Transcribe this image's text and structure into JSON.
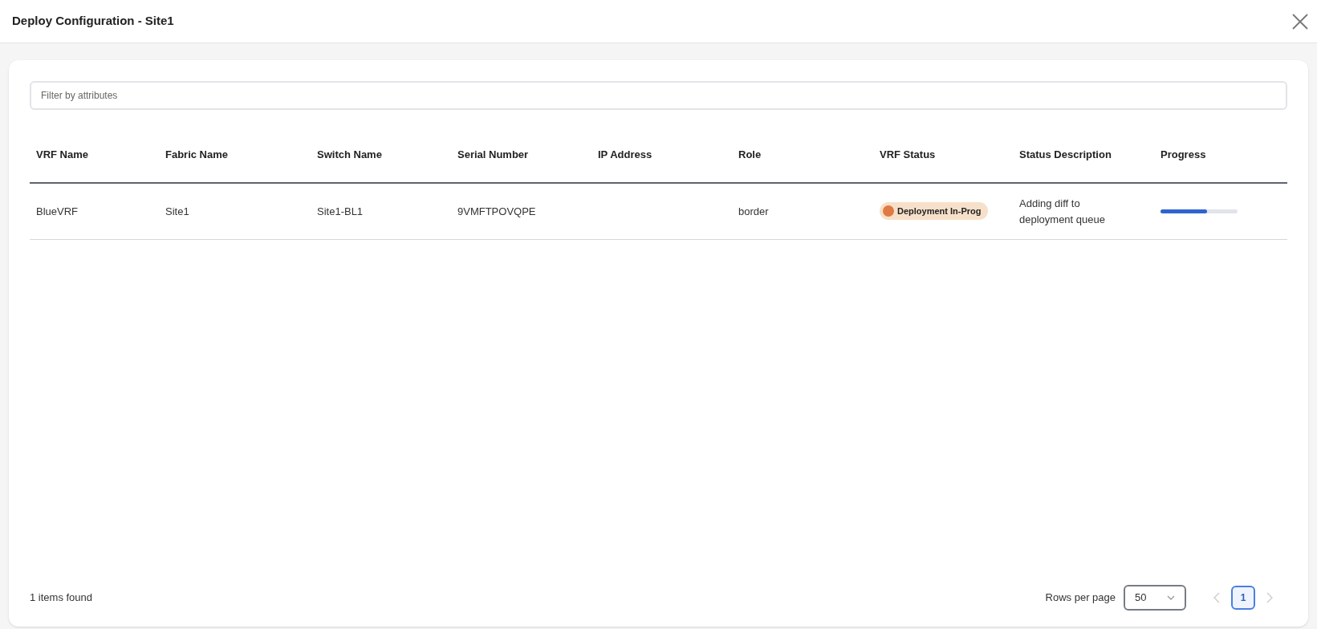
{
  "dialog": {
    "title": "Deploy Configuration - Site1"
  },
  "filter": {
    "placeholder": "Filter by attributes"
  },
  "table": {
    "columns": [
      "VRF Name",
      "Fabric Name",
      "Switch Name",
      "Serial Number",
      "IP Address",
      "Role",
      "VRF Status",
      "Status Description",
      "Progress"
    ],
    "rows": [
      {
        "vrf_name": "BlueVRF",
        "fabric_name": "Site1",
        "switch_name": "Site1-BL1",
        "serial_number": "9VMFTPOVQPE",
        "ip_address": "",
        "role": "border",
        "vrf_status": {
          "label": "Deployment In-Prog",
          "color": "#e07a45"
        },
        "status_description": "Adding diff to deployment queue",
        "progress": {
          "level": 0.6
        }
      }
    ]
  },
  "footer": {
    "count": "1 items found",
    "rows_per_page_label": "Rows per page",
    "rows_per_page": "50",
    "pages": [
      {
        "label": "1",
        "selected": true
      }
    ],
    "prev_disabled": true,
    "next_disabled": true
  }
}
